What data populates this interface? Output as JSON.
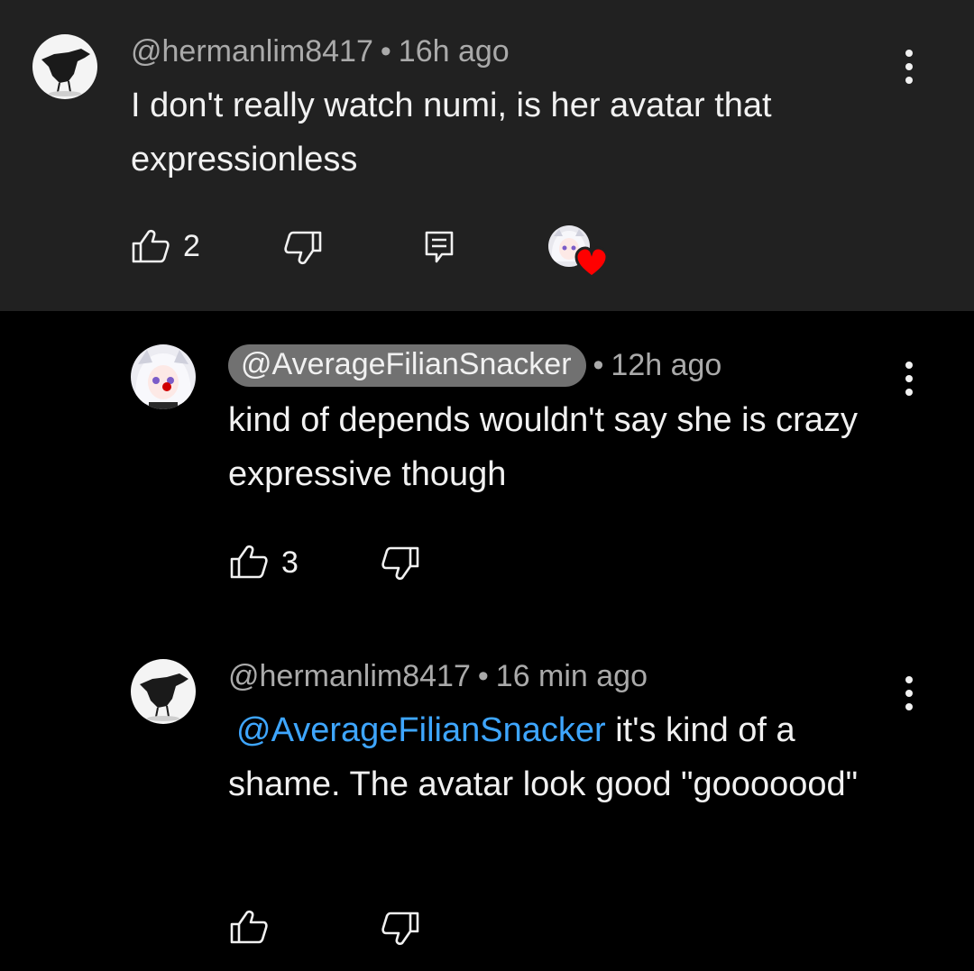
{
  "comments": [
    {
      "author": "@hermanlim8417",
      "time": "16h ago",
      "text": "I don't really watch numi, is her avatar that expressionless",
      "likes": "2"
    },
    {
      "author": "@AverageFilianSnacker",
      "time": "12h ago",
      "text": "kind of depends wouldn't say she is crazy expressive though",
      "likes": "3"
    },
    {
      "author": "@hermanlim8417",
      "time": "16 min ago",
      "mention": "@AverageFilianSnacker",
      "text": " it's kind of a shame. The avatar look good \"gooooood\"",
      "likes": ""
    }
  ],
  "separator": "•",
  "icons": [
    "avatar-crow-icon",
    "avatar-anime-icon",
    "like-icon",
    "dislike-icon",
    "reply-icon",
    "creator-heart-icon",
    "more-icon"
  ],
  "colors": {
    "parent_bg": "#212121",
    "page_bg": "#000000",
    "mention": "#3ea6ff",
    "heart": "#ff0000"
  }
}
